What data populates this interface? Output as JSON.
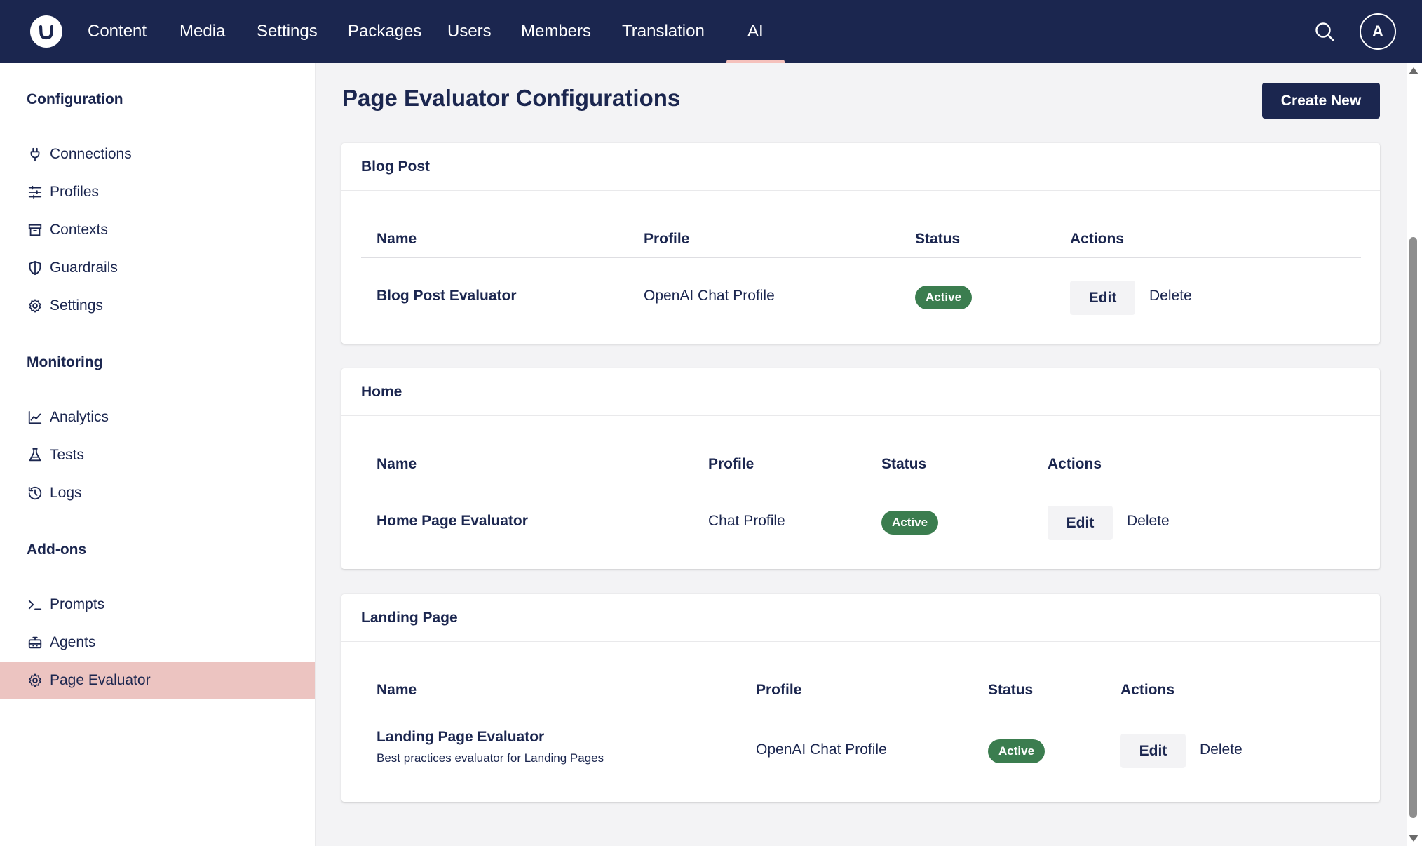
{
  "topnav": {
    "items": [
      {
        "label": "Content"
      },
      {
        "label": "Media"
      },
      {
        "label": "Settings"
      },
      {
        "label": "Packages"
      },
      {
        "label": "Users"
      },
      {
        "label": "Members"
      },
      {
        "label": "Translation"
      },
      {
        "label": "AI",
        "active": true
      }
    ],
    "search_icon": "search-icon",
    "avatar_initial": "A"
  },
  "sidebar": {
    "sections": [
      {
        "heading": "Configuration",
        "items": [
          {
            "label": "Connections",
            "icon": "plug-icon"
          },
          {
            "label": "Profiles",
            "icon": "sliders-icon"
          },
          {
            "label": "Contexts",
            "icon": "archive-icon"
          },
          {
            "label": "Guardrails",
            "icon": "shield-icon"
          },
          {
            "label": "Settings",
            "icon": "gear-icon"
          }
        ]
      },
      {
        "heading": "Monitoring",
        "items": [
          {
            "label": "Analytics",
            "icon": "chart-line-icon"
          },
          {
            "label": "Tests",
            "icon": "flask-icon"
          },
          {
            "label": "Logs",
            "icon": "history-icon"
          }
        ]
      },
      {
        "heading": "Add-ons",
        "items": [
          {
            "label": "Prompts",
            "icon": "terminal-icon"
          },
          {
            "label": "Agents",
            "icon": "robot-icon"
          },
          {
            "label": "Page Evaluator",
            "icon": "gear-icon",
            "selected": true
          }
        ]
      }
    ]
  },
  "main": {
    "title": "Page Evaluator Configurations",
    "create_button": "Create New",
    "cards": [
      {
        "title": "Blog Post",
        "columns": [
          "Name",
          "Profile",
          "Status",
          "Actions"
        ],
        "rows": [
          {
            "name": "Blog Post Evaluator",
            "description": "",
            "profile": "OpenAI Chat Profile",
            "status": "Active",
            "edit": "Edit",
            "delete": "Delete"
          }
        ]
      },
      {
        "title": "Home",
        "columns": [
          "Name",
          "Profile",
          "Status",
          "Actions"
        ],
        "rows": [
          {
            "name": "Home Page Evaluator",
            "description": "",
            "profile": "Chat Profile",
            "status": "Active",
            "edit": "Edit",
            "delete": "Delete"
          }
        ]
      },
      {
        "title": "Landing Page",
        "columns": [
          "Name",
          "Profile",
          "Status",
          "Actions"
        ],
        "rows": [
          {
            "name": "Landing Page Evaluator",
            "description": "Best practices evaluator for Landing Pages",
            "profile": "OpenAI Chat Profile",
            "status": "Active",
            "edit": "Edit",
            "delete": "Delete"
          }
        ]
      }
    ]
  },
  "colors": {
    "topbar": "#1b264f",
    "active_indicator": "#f5c1bc",
    "selected_item": "#ecc4c1",
    "status_active": "#3b7d4f"
  }
}
